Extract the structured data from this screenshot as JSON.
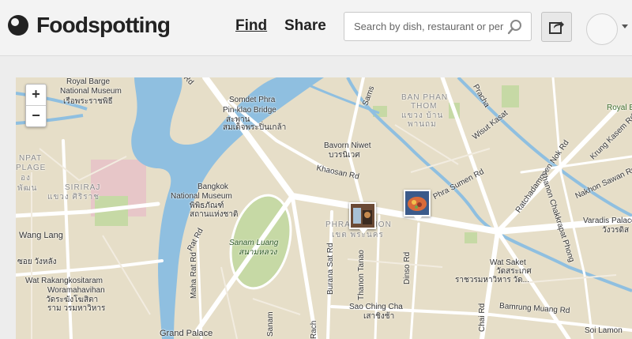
{
  "header": {
    "brand": "Foodspotting",
    "nav": {
      "find": "Find",
      "share": "Share"
    },
    "search_placeholder": "Search by dish, restaurant or person"
  },
  "map": {
    "zoom_in": "+",
    "zoom_out": "−",
    "labels": {
      "royal_barge": "Royal Barge",
      "national_museum": "National Museum",
      "royal_barge_th": "เรือพระราชพิธี",
      "somdet": "Somdet Phra",
      "pinklao": "Pin-klao Bridge",
      "saphan": "สะพาน",
      "somdet_th": "สมเด็จพระปิ่นเกล้า",
      "ban_phan": "BAN PHAN",
      "thom": "THOM",
      "ban_phan_th": "แขวง บ้าน",
      "phan_thom_th": "พานถม",
      "bavorn": "Bavorn Niwet",
      "bavorn_th": "บวรนิเวศ",
      "khaosan": "Khaosan Rd",
      "bangkok": "Bangkok",
      "nat_museum2": "National Museum",
      "museum_th1": "พิพิธภัณฑ์",
      "museum_th2": "สถานแห่งชาติ",
      "siriraj": "SIRIRAJ",
      "siriraj_th": "แขวง ศิริราช",
      "nunpat": "NPAT",
      "plage": "PLAGE",
      "ang": "อง",
      "phan": "พัฒน",
      "wang_lang": "Wang Lang",
      "soi_wanlai": "ซอย วังหลัง",
      "wat_rakhang": "Wat Rakangkositaram",
      "woramahaviharn": "Woramahavihan",
      "wat_rakhang_th": "วัดระฆังโฆสิตา",
      "wat_rakhang_th2": "ราม วรมหาวิหาร",
      "sanam_luang": "Sanam Luang",
      "sanam_luang_th": "สนามหลวง",
      "phra_nakhon": "PHRA NAKHON",
      "phra_nakhon_th": "เขต พระนคร",
      "burana_sat": "Burana Sat Rd",
      "thanon_tanao": "Thanon Tanao",
      "dinso": "Dinso Rd",
      "sao_ching_cha": "Sao Ching Cha",
      "sao_ching_cha_th": "เสาชิงช้า",
      "grand_palace": "Grand Palace",
      "maha_rat": "Maha Rat Rd",
      "sanam": "Sanam",
      "phra_sumen": "Phra Sumen Rd",
      "wisut_kasat": "Wisut Kasat",
      "ratchadamnoen": "Ratchadamnoen Nok Rd",
      "krung_kasem": "Krung Kasem Rd",
      "nakhon_sawan": "Nakhon Sawan Rd",
      "thanon_chakkrapat": "Thanon Chakkrapat Phong",
      "varadis": "Varadis Palace",
      "varadis_th": "วังวรดิส",
      "royal_bu": "Royal Bu",
      "wat_saket": "Wat Saket",
      "wat_saket_th": "วัดสระเกศ",
      "wat_saket_th2": "ราชวรมหาวิหาร วัด...",
      "bamrung_muang": "Bamrung Muang Rd",
      "soi_lamon": "Soi Lamon",
      "chai_rd": "Chai Rd",
      "prachathipatai": "Pracha",
      "samsen": "Sams",
      "rach": "Rach",
      "rat_rd": "Rat Rd",
      "rd_rd": "Rd"
    }
  },
  "colors": {
    "water": "#8fbfe0",
    "land": "#e6dec8",
    "road": "#ffffff",
    "park": "#c6d9a5",
    "hospital": "#e7c6c8",
    "brand": "#222222"
  },
  "icons": [
    "logo-icon",
    "search-icon",
    "share-icon",
    "chevron-down-icon",
    "food-photo-marker"
  ]
}
